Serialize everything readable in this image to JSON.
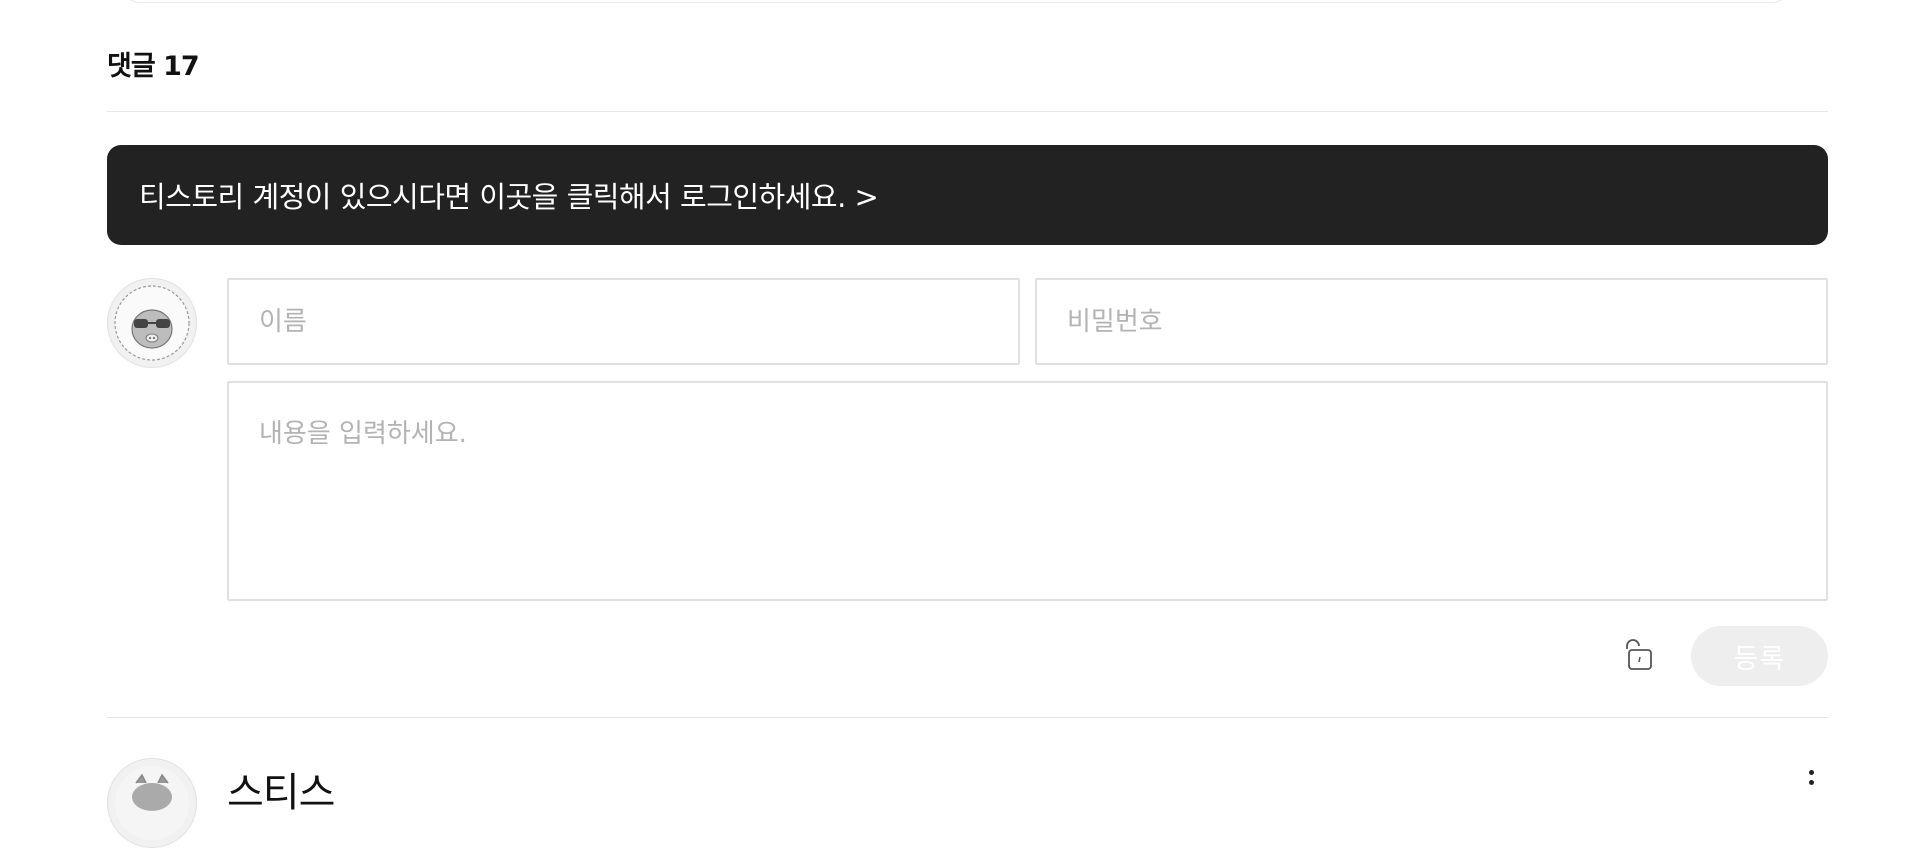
{
  "comments": {
    "title": "댓글 17",
    "login_banner": "티스토리 계정이 있으시다면 이곳을 클릭해서 로그인하세요. >",
    "form": {
      "name_placeholder": "이름",
      "password_placeholder": "비밀번호",
      "content_placeholder": "내용을 입력하세요.",
      "submit_label": "등록",
      "lock_icon": "unlock-icon",
      "avatar_icon": "default-avatar-icon"
    },
    "first_comment": {
      "author": "스티스"
    }
  },
  "colors": {
    "banner_bg": "#222222",
    "submit_bg": "#eeeeee",
    "border": "#e0e0e0"
  }
}
